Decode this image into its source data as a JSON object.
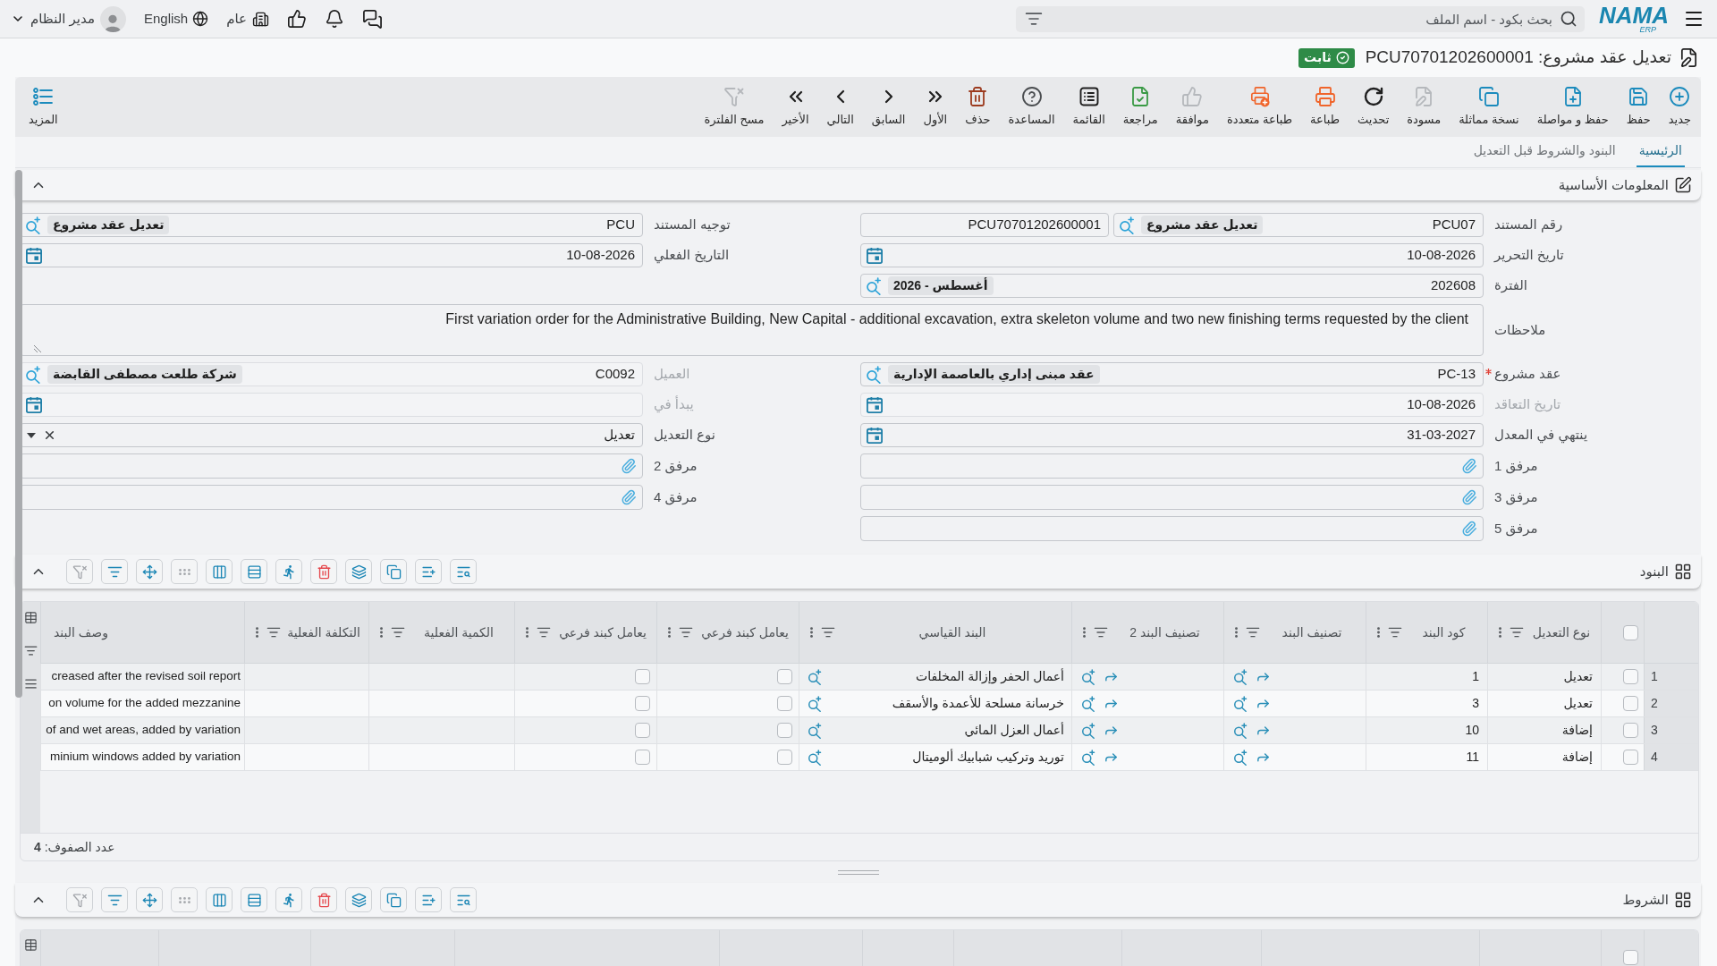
{
  "top_bar": {
    "logo": {
      "wordmark": "NAMA",
      "subtitle": "ERP"
    },
    "search": {
      "placeholder": "بحث بكود - اسم الملف"
    },
    "company": "عام",
    "language": "English",
    "user": "مدير النظام"
  },
  "document": {
    "title": "تعديل عقد مشروع: PCU70701202600001",
    "status": "ثابت"
  },
  "toolbar": {
    "buttons": [
      {
        "label": "جديد",
        "kind": "new",
        "disabled": false
      },
      {
        "label": "حفظ",
        "kind": "save",
        "disabled": false
      },
      {
        "label": "حفظ و مواصلة",
        "kind": "savenext",
        "disabled": false
      },
      {
        "label": "نسخة مماثلة",
        "kind": "duplicate",
        "disabled": false
      },
      {
        "label": "مسودة",
        "kind": "draft",
        "disabled": true
      },
      {
        "label": "تحديث",
        "kind": "refresh",
        "disabled": false
      },
      {
        "label": "طباعة",
        "kind": "print",
        "disabled": false
      },
      {
        "label": "طباعة متعددة",
        "kind": "multiprint",
        "disabled": false
      },
      {
        "label": "موافقة",
        "kind": "approve",
        "disabled": true
      },
      {
        "label": "مراجعة",
        "kind": "review",
        "disabled": false
      },
      {
        "label": "القائمة",
        "kind": "list",
        "disabled": false
      },
      {
        "label": "المساعدة",
        "kind": "help",
        "disabled": false
      },
      {
        "label": "حذف",
        "kind": "delete",
        "disabled": false
      },
      {
        "label": "الأول",
        "kind": "first",
        "disabled": false
      },
      {
        "label": "السابق",
        "kind": "previous",
        "disabled": false
      },
      {
        "label": "التالي",
        "kind": "next",
        "disabled": false
      },
      {
        "label": "الأخير",
        "kind": "last",
        "disabled": false
      },
      {
        "label": "مسح الفلترة",
        "kind": "clearfilter",
        "disabled": true
      }
    ],
    "more": {
      "label": "المزيد"
    }
  },
  "tabs": [
    {
      "label": "الرئيسية",
      "selected": true
    },
    {
      "label": "البنود والشروط قبل التعديل",
      "selected": false
    }
  ],
  "basic_info": {
    "title": "المعلومات الأساسية",
    "expanded": true,
    "rows": [
      [
        {
          "label": "رقم المستند",
          "kind": "docnumber",
          "value": "PCU07",
          "tag": "تعديل عقد مشروع",
          "serial": "PCU70701202600001",
          "required": false,
          "disabled": false
        },
        {
          "label": "توجيه المستند",
          "kind": "lookup",
          "value": "PCU",
          "tag": "تعديل عقد مشروع",
          "required": false,
          "disabled": false
        }
      ],
      [
        {
          "label": "تاريخ التحرير",
          "kind": "date",
          "value": "10-08-2026",
          "required": false,
          "disabled": false
        },
        {
          "label": "التاريخ الفعلي",
          "kind": "date",
          "value": "10-08-2026",
          "required": false,
          "disabled": false
        }
      ],
      [
        {
          "label": "الفترة",
          "kind": "lookup",
          "value": "202608",
          "tag": "أغسطس - 2026",
          "required": false,
          "disabled": false
        }
      ],
      [
        {
          "label": "ملاحظات",
          "kind": "notes",
          "value": "First variation order for the Administrative Building, New Capital - additional excavation, extra skeleton volume and two new finishing terms requested by the client",
          "required": false,
          "disabled": false
        }
      ],
      [
        {
          "label": "عقد مشروع",
          "kind": "lookup",
          "value": "PC-13",
          "tag": "عقد مبنى إداري بالعاصمة الإدارية",
          "required": true,
          "disabled": false
        },
        {
          "label": "العميل",
          "kind": "lookup",
          "value": "C0092",
          "tag": "شركة طلعت مصطفى القابضة",
          "required": false,
          "disabled": true
        }
      ],
      [
        {
          "label": "تاريخ التعاقد",
          "kind": "date",
          "value": "10-08-2026",
          "required": false,
          "disabled": true
        },
        {
          "label": "يبدأ في",
          "kind": "date",
          "required": false,
          "disabled": true
        }
      ],
      [
        {
          "label": "ينتهي في المعدل",
          "kind": "date",
          "value": "31-03-2027",
          "required": false,
          "disabled": false
        },
        {
          "label": "نوع التعديل",
          "kind": "select",
          "value": "تعديل",
          "required": false,
          "disabled": false
        }
      ],
      [
        {
          "label": "مرفق 1",
          "kind": "attachment",
          "required": false,
          "disabled": false
        },
        {
          "label": "مرفق 2",
          "kind": "attachment",
          "required": false,
          "disabled": false
        }
      ],
      [
        {
          "label": "مرفق 3",
          "kind": "attachment",
          "required": false,
          "disabled": false
        },
        {
          "label": "مرفق 4",
          "kind": "attachment",
          "required": false,
          "disabled": false
        }
      ],
      [
        {
          "label": "مرفق 5",
          "kind": "attachment",
          "required": false,
          "disabled": false
        }
      ]
    ]
  },
  "items": {
    "title": "البنود",
    "expanded": true,
    "tools": [
      {
        "kind": "find",
        "disabled": false
      },
      {
        "kind": "addrow",
        "disabled": false
      },
      {
        "kind": "copy",
        "disabled": false
      },
      {
        "kind": "layers",
        "disabled": false
      },
      {
        "kind": "delete",
        "disabled": false
      },
      {
        "kind": "run",
        "disabled": false
      },
      {
        "kind": "group",
        "disabled": false
      },
      {
        "kind": "fit",
        "disabled": false
      },
      {
        "kind": "dots",
        "disabled": true
      },
      {
        "kind": "move",
        "disabled": false
      },
      {
        "kind": "filter",
        "disabled": false
      },
      {
        "kind": "clearfilter",
        "disabled": true
      }
    ],
    "grid": {
      "select_all": false,
      "columns": [
        {
          "label": "نوع التعديل",
          "menu": true
        },
        {
          "label": "كود البند",
          "menu": true
        },
        {
          "label": "تصنيف البند",
          "menu": true
        },
        {
          "label": "تصنيف البند 2",
          "menu": true
        },
        {
          "label": "البند القياسي",
          "menu": true
        },
        {
          "label": "يعامل كبند فرعي",
          "menu": true
        },
        {
          "label": "يعامل كبند فرعي",
          "menu": true
        },
        {
          "label": "الكمية الفعلية",
          "menu": true
        },
        {
          "label": "التكلفة الفعلية",
          "menu": true
        },
        {
          "label": "وصف البند",
          "menu": false
        }
      ],
      "rows": [
        {
          "no": "1",
          "checked": false,
          "cells": [
            {
              "kind": "text",
              "text": "تعديل"
            },
            {
              "kind": "text",
              "text": "1"
            },
            {
              "kind": "lookup"
            },
            {
              "kind": "lookup"
            },
            {
              "kind": "standard",
              "text": "أعمال الحفر وإزالة المخلفات"
            },
            {
              "kind": "check",
              "checked": false
            },
            {
              "kind": "check",
              "checked": false
            },
            {
              "kind": "empty"
            },
            {
              "kind": "empty"
            },
            {
              "kind": "text",
              "text": "creased after the revised soil report"
            }
          ]
        },
        {
          "no": "2",
          "checked": false,
          "cells": [
            {
              "kind": "text",
              "text": "تعديل"
            },
            {
              "kind": "text",
              "text": "3"
            },
            {
              "kind": "lookup"
            },
            {
              "kind": "lookup"
            },
            {
              "kind": "standard",
              "text": "خرسانة مسلحة للأعمدة والأسقف"
            },
            {
              "kind": "check",
              "checked": false
            },
            {
              "kind": "check",
              "checked": false
            },
            {
              "kind": "empty"
            },
            {
              "kind": "empty"
            },
            {
              "kind": "text",
              "text": "on volume for the added mezzanine"
            }
          ]
        },
        {
          "no": "3",
          "checked": false,
          "cells": [
            {
              "kind": "text",
              "text": "إضافة"
            },
            {
              "kind": "text",
              "text": "10"
            },
            {
              "kind": "lookup"
            },
            {
              "kind": "lookup"
            },
            {
              "kind": "standard",
              "text": "أعمال العزل المائي"
            },
            {
              "kind": "check",
              "checked": false
            },
            {
              "kind": "check",
              "checked": false
            },
            {
              "kind": "empty"
            },
            {
              "kind": "empty"
            },
            {
              "kind": "text",
              "text": "of and wet areas, added by variation"
            }
          ]
        },
        {
          "no": "4",
          "checked": false,
          "cells": [
            {
              "kind": "text",
              "text": "إضافة"
            },
            {
              "kind": "text",
              "text": "11"
            },
            {
              "kind": "lookup"
            },
            {
              "kind": "lookup"
            },
            {
              "kind": "standard",
              "text": "توريد وتركيب شبابيك ألوميتال"
            },
            {
              "kind": "check",
              "checked": false
            },
            {
              "kind": "check",
              "checked": false
            },
            {
              "kind": "empty"
            },
            {
              "kind": "empty"
            },
            {
              "kind": "text",
              "text": "minium windows added by variation"
            }
          ]
        }
      ],
      "footer": "عدد الصفوف: **4**"
    }
  },
  "terms": {
    "title": "الشروط",
    "expanded": true,
    "tools": [
      {
        "kind": "find",
        "disabled": false
      },
      {
        "kind": "addrow",
        "disabled": false
      },
      {
        "kind": "copy",
        "disabled": false
      },
      {
        "kind": "layers",
        "disabled": false
      },
      {
        "kind": "delete",
        "disabled": false
      },
      {
        "kind": "run",
        "disabled": false
      },
      {
        "kind": "group",
        "disabled": false
      },
      {
        "kind": "fit",
        "disabled": false
      },
      {
        "kind": "dots",
        "disabled": true
      },
      {
        "kind": "move",
        "disabled": false
      },
      {
        "kind": "filter",
        "disabled": false
      },
      {
        "kind": "clearfilter",
        "disabled": true
      }
    ],
    "grid": {
      "select_all": false
    }
  }
}
